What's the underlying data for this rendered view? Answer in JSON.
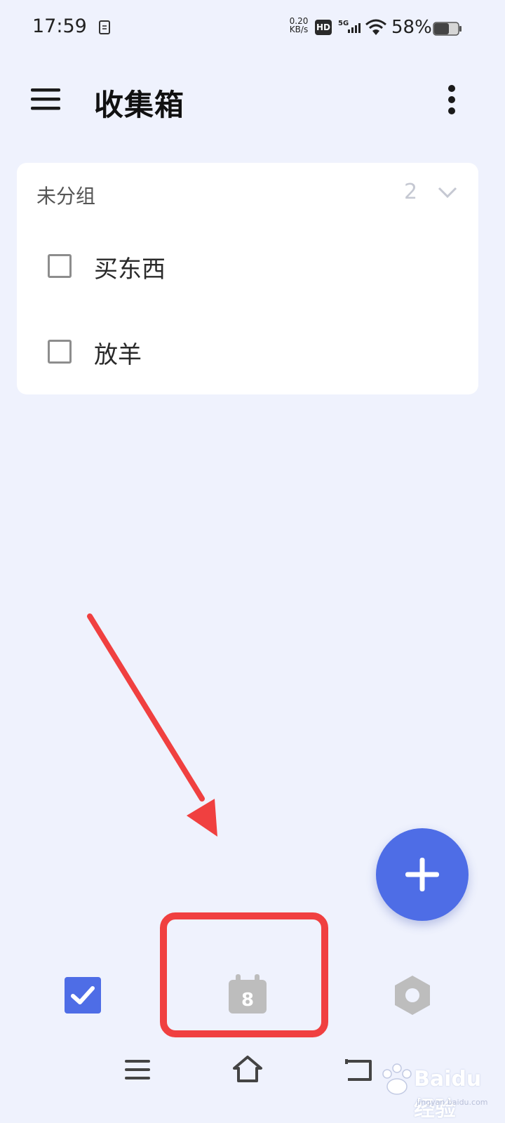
{
  "status_bar": {
    "time": "17:59",
    "net_speed_value": "0.20",
    "net_speed_unit": "KB/s",
    "hd_label": "HD",
    "network_label": "5G",
    "battery_percent": "58%"
  },
  "app_bar": {
    "title": "收集箱"
  },
  "group": {
    "title": "未分组",
    "count": "2",
    "tasks": [
      {
        "label": "买东西",
        "checked": false
      },
      {
        "label": "放羊",
        "checked": false
      }
    ]
  },
  "bottom_tabs": {
    "calendar_day": "8"
  },
  "colors": {
    "accent": "#4e6de6",
    "tab_active": "#4e6de6",
    "annotation": "#f04040",
    "background": "#eff2fd"
  },
  "icons": [
    "menu-icon",
    "more-vertical-icon",
    "chevron-down-icon",
    "plus-icon",
    "check-square-icon",
    "calendar-icon",
    "settings-hex-icon",
    "nav-menu-icon",
    "nav-home-icon",
    "nav-back-icon"
  ],
  "watermark": {
    "text": "Baidu经验",
    "sub": "jingyan.baidu.com"
  }
}
